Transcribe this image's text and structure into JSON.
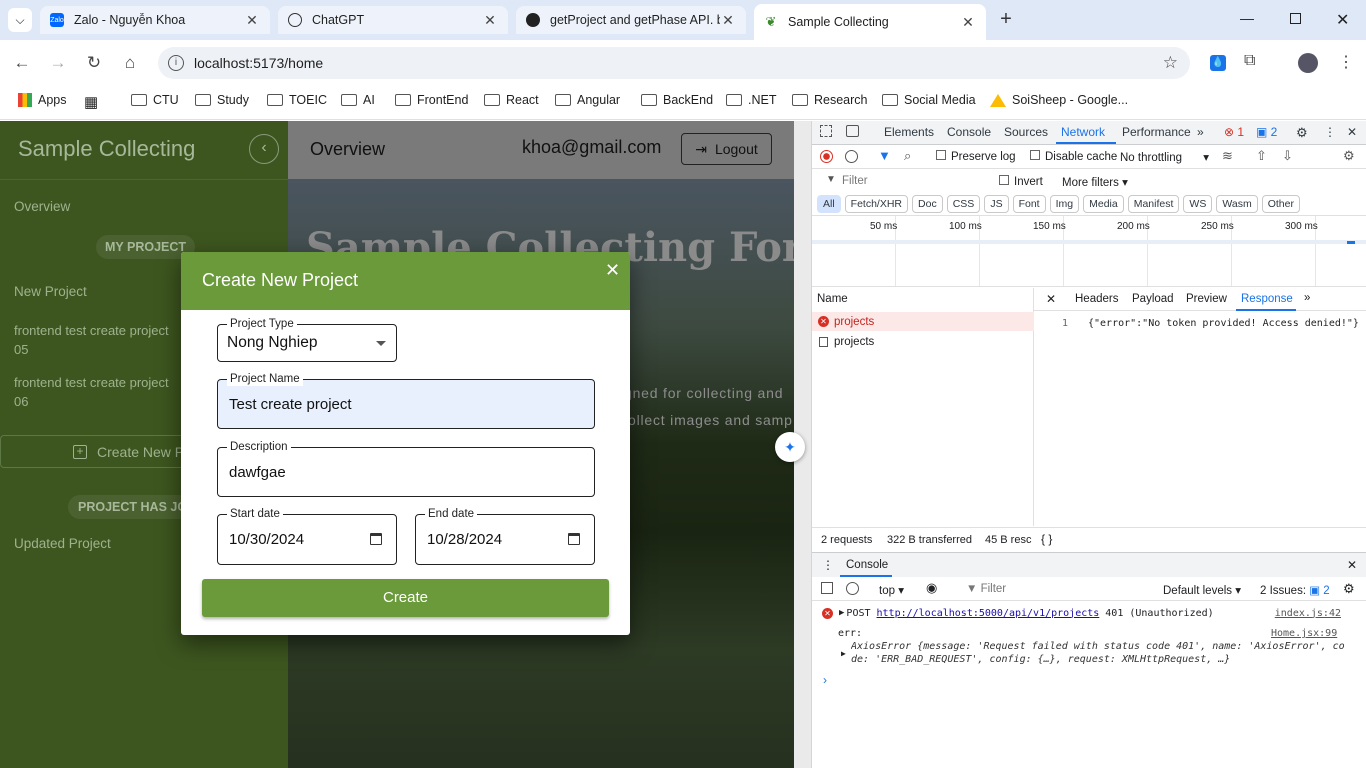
{
  "browser": {
    "tabs": [
      {
        "title": "Zalo - Nguyễn Khoa",
        "icon": "zalo-icon"
      },
      {
        "title": "ChatGPT",
        "icon": "chatgpt-icon"
      },
      {
        "title": "getProject and getPhase API. by",
        "icon": "github-icon"
      },
      {
        "title": "Sample Collecting",
        "icon": "sprout-icon"
      }
    ],
    "url": "localhost:5173/home",
    "bookmarks": [
      "Apps",
      "CTU",
      "Study",
      "TOEIC",
      "AI",
      "FrontEnd",
      "React",
      "Angular",
      "BackEnd",
      ".NET",
      "Research",
      "Social Media",
      "SoiSheep - Google..."
    ]
  },
  "sidebar": {
    "title": "Sample Collecting",
    "overview": "Overview",
    "my_project_header": "MY PROJECT",
    "items": [
      "New Project",
      "frontend test create project 05",
      "frontend test create project 06"
    ],
    "create_button": "Create New P",
    "has_job_header": "PROJECT HAS JO",
    "updated": "Updated Project"
  },
  "header": {
    "title": "Overview",
    "email": "khoa@gmail.com",
    "logout": "Logout"
  },
  "hero": {
    "title": "Sample Collecting For",
    "line1": "gned for collecting and",
    "line2": "ollect images and samp"
  },
  "modal": {
    "title": "Create New Project",
    "project_type_label": "Project Type",
    "project_type_value": "Nong Nghiep",
    "project_name_label": "Project Name",
    "project_name_value": "Test create project",
    "description_label": "Description",
    "description_value": "dawfgae",
    "start_label": "Start date",
    "start_value": "10/30/2024",
    "end_label": "End date",
    "end_value": "10/28/2024",
    "create_button": "Create"
  },
  "devtools": {
    "tabs": [
      "Elements",
      "Console",
      "Sources",
      "Network",
      "Performance"
    ],
    "active_tab": "Network",
    "error_count": "1",
    "issue_count": "2",
    "preserve_log": "Preserve log",
    "disable_cache": "Disable cache",
    "throttling": "No throttling",
    "filter_placeholder": "Filter",
    "invert": "Invert",
    "more_filters": "More filters",
    "type_filters": [
      "All",
      "Fetch/XHR",
      "Doc",
      "CSS",
      "JS",
      "Font",
      "Img",
      "Media",
      "Manifest",
      "WS",
      "Wasm",
      "Other"
    ],
    "timeline_ticks": [
      "50 ms",
      "100 ms",
      "150 ms",
      "200 ms",
      "250 ms",
      "300 ms"
    ],
    "name_header": "Name",
    "requests": [
      "projects",
      "projects"
    ],
    "detail_tabs": [
      "Headers",
      "Payload",
      "Preview",
      "Response"
    ],
    "response_line_no": "1",
    "response_body": "{\"error\":\"No token provided! Access denied!\"}",
    "status_requests": "2 requests",
    "status_transferred": "322 B transferred",
    "status_resources": "45 B resc",
    "console_tab": "Console",
    "console_context": "top",
    "console_filter": "Filter",
    "console_levels": "Default levels",
    "console_issues": "2 Issues:",
    "console_issue_count": "2",
    "log_method": "POST",
    "log_url": "http://localhost:5000/api/v1/projects",
    "log_status": "401 (Unauthorized)",
    "log_source": "index.js:42",
    "err_label": "err:",
    "err_source": "Home.jsx:99",
    "err_line1": "AxiosError {message: 'Request failed with status code 401', name: 'AxiosError', co",
    "err_line2": "de: 'ERR_BAD_REQUEST', config: {…}, request: XMLHttpRequest, …}"
  }
}
